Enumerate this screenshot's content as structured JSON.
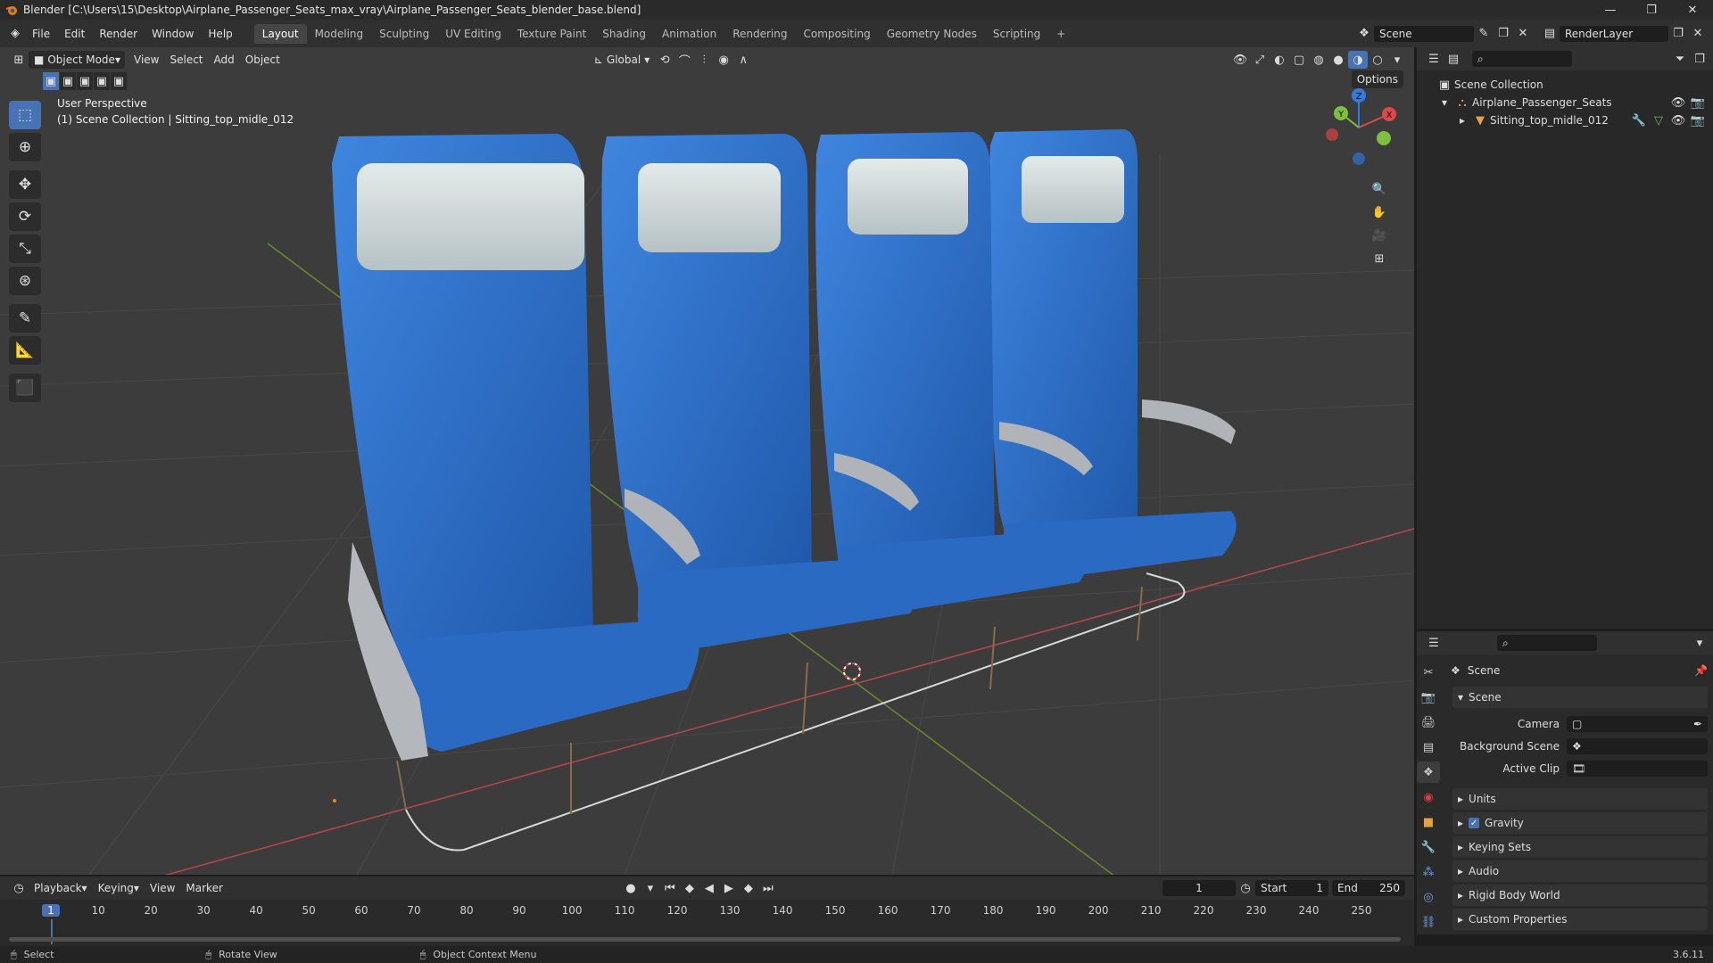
{
  "window": {
    "title": "Blender [C:\\Users\\15\\Desktop\\Airplane_Passenger_Seats_max_vray\\Airplane_Passenger_Seats_blender_base.blend]",
    "controls": [
      "—",
      "❐",
      "✕"
    ]
  },
  "menu": {
    "items": [
      "File",
      "Edit",
      "Render",
      "Window",
      "Help"
    ],
    "workspaces": [
      "Layout",
      "Modeling",
      "Sculpting",
      "UV Editing",
      "Texture Paint",
      "Shading",
      "Animation",
      "Rendering",
      "Compositing",
      "Geometry Nodes",
      "Scripting"
    ],
    "active_workspace": "Layout",
    "add_tab": "+",
    "scene": "Scene",
    "view_layer": "RenderLayer"
  },
  "viewport": {
    "mode": "Object Mode",
    "menus": [
      "View",
      "Select",
      "Add",
      "Object"
    ],
    "orientation": "Global",
    "options": "Options",
    "perspective": "User Perspective",
    "context": "(1) Scene Collection | Sitting_top_midle_012",
    "gizmo": {
      "x": "X",
      "y": "Y",
      "z": "Z"
    },
    "colors": {
      "seat_blue": "#2d6fc9",
      "headrest": "#d2dcdc",
      "frame": "#b4b8bc",
      "background": "#3c3c3c",
      "x_axis": "#d9534f",
      "y_axis": "#8bc34a"
    }
  },
  "outliner": {
    "root": "Scene Collection",
    "collection": "Airplane_Passenger_Seats",
    "object": "Sitting_top_midle_012"
  },
  "properties": {
    "header": "Scene",
    "section": "Scene",
    "fields": [
      {
        "label": "Camera",
        "value": ""
      },
      {
        "label": "Background Scene",
        "value": ""
      },
      {
        "label": "Active Clip",
        "value": ""
      }
    ],
    "panels": [
      {
        "label": "Units",
        "checkbox": false
      },
      {
        "label": "Gravity",
        "checkbox": true
      },
      {
        "label": "Keying Sets",
        "checkbox": false
      },
      {
        "label": "Audio",
        "checkbox": false
      },
      {
        "label": "Rigid Body World",
        "checkbox": false
      },
      {
        "label": "Custom Properties",
        "checkbox": false
      }
    ]
  },
  "timeline": {
    "menus": [
      "Playback",
      "Keying",
      "View",
      "Marker"
    ],
    "current_frame": "1",
    "start_label": "Start",
    "start": "1",
    "end_label": "End",
    "end": "250",
    "ticks": [
      "1",
      "10",
      "20",
      "30",
      "40",
      "50",
      "60",
      "70",
      "80",
      "90",
      "100",
      "110",
      "120",
      "130",
      "140",
      "150",
      "160",
      "170",
      "180",
      "190",
      "200",
      "210",
      "220",
      "230",
      "240",
      "250"
    ]
  },
  "status": {
    "select": "Select",
    "rotate": "Rotate View",
    "context_menu": "Object Context Menu",
    "version": "3.6.11"
  }
}
